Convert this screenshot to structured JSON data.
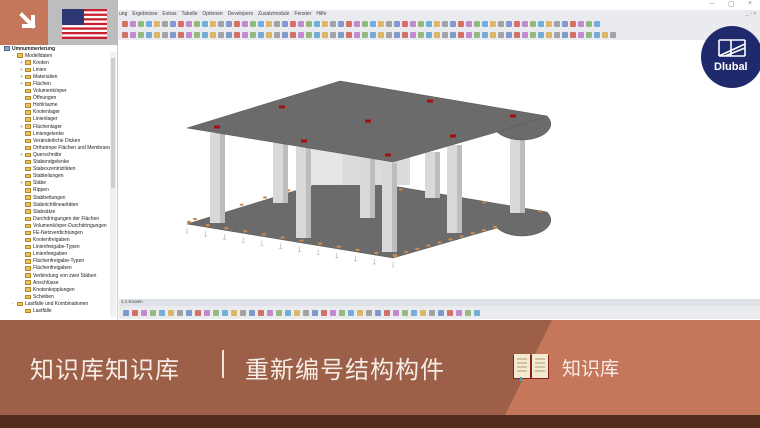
{
  "window": {
    "minimize": "–",
    "maximize": "▢",
    "close": "×",
    "child_controls": "_ ▫ ×"
  },
  "menu": [
    "ung",
    "Ergebnisse",
    "Extras",
    "Tabelle",
    "Optionen",
    "Developers",
    "Zusatzmodule",
    "Fenster",
    "Hilfe"
  ],
  "tree": {
    "root": "Umnummerierung",
    "items": [
      {
        "label": "Modelldaten",
        "level": 1,
        "expander": "-"
      },
      {
        "label": "Knoten",
        "level": 2,
        "expander": "+"
      },
      {
        "label": "Linien",
        "level": 2,
        "expander": "+"
      },
      {
        "label": "Materialien",
        "level": 2,
        "expander": "+"
      },
      {
        "label": "Flächen",
        "level": 2,
        "expander": "+"
      },
      {
        "label": "Volumenkörper",
        "level": 2,
        "expander": ""
      },
      {
        "label": "Öffnungen",
        "level": 2,
        "expander": ""
      },
      {
        "label": "Hohlräume",
        "level": 2,
        "expander": ""
      },
      {
        "label": "Knotenlager",
        "level": 2,
        "expander": ""
      },
      {
        "label": "Linienlager",
        "level": 2,
        "expander": ""
      },
      {
        "label": "Flächenlager",
        "level": 2,
        "expander": "+"
      },
      {
        "label": "Liniengelenke",
        "level": 2,
        "expander": ""
      },
      {
        "label": "Veränderliche Dicken",
        "level": 2,
        "expander": ""
      },
      {
        "label": "Orthotrope Flächen und Membranen",
        "level": 2,
        "expander": ""
      },
      {
        "label": "Querschnitte",
        "level": 2,
        "expander": "+"
      },
      {
        "label": "Stabendgelenke",
        "level": 2,
        "expander": ""
      },
      {
        "label": "Stabexzentrizitäten",
        "level": 2,
        "expander": ""
      },
      {
        "label": "Stabteilungen",
        "level": 2,
        "expander": ""
      },
      {
        "label": "Stäbe",
        "level": 2,
        "expander": "+"
      },
      {
        "label": "Rippen",
        "level": 2,
        "expander": ""
      },
      {
        "label": "Stabbettungen",
        "level": 2,
        "expander": ""
      },
      {
        "label": "Stabnichtlinearitäten",
        "level": 2,
        "expander": ""
      },
      {
        "label": "Stabsätze",
        "level": 2,
        "expander": ""
      },
      {
        "label": "Durchdringungen der Flächen",
        "level": 2,
        "expander": ""
      },
      {
        "label": "Volumenkörper-Durchdringungen",
        "level": 2,
        "expander": ""
      },
      {
        "label": "FE-Netzverdichtungen",
        "level": 2,
        "expander": ""
      },
      {
        "label": "Knotenfreigaben",
        "level": 2,
        "expander": ""
      },
      {
        "label": "Linienfreigabe-Typen",
        "level": 2,
        "expander": ""
      },
      {
        "label": "Linienfreigaben",
        "level": 2,
        "expander": ""
      },
      {
        "label": "Flächenfreigabe-Typen",
        "level": 2,
        "expander": ""
      },
      {
        "label": "Flächenfreigaben",
        "level": 2,
        "expander": ""
      },
      {
        "label": "Verbindung von zwei Stäben",
        "level": 2,
        "expander": ""
      },
      {
        "label": "Anschlüsse",
        "level": 2,
        "expander": ""
      },
      {
        "label": "Knotenkopplungen",
        "level": 2,
        "expander": ""
      },
      {
        "label": "Scheiben",
        "level": 2,
        "expander": ""
      },
      {
        "label": "Lastfälle und Kombinationen",
        "level": 1,
        "expander": "-"
      },
      {
        "label": "Lastfälle",
        "level": 2,
        "expander": ""
      }
    ]
  },
  "panel": {
    "title": "1.1 Knoten"
  },
  "banner": {
    "title": "知识库知识库",
    "separator": "|",
    "subtitle": "重新编号结构构件",
    "kb_label": "知识库"
  },
  "logo": {
    "text": "Dlubal"
  },
  "colors": {
    "accent": "#c5775b",
    "banner_dark": "#9c5f48",
    "footer": "#532c20",
    "logo": "#1f2a6d",
    "slab": "#6b6b6b",
    "column": "#d4d4d4"
  }
}
